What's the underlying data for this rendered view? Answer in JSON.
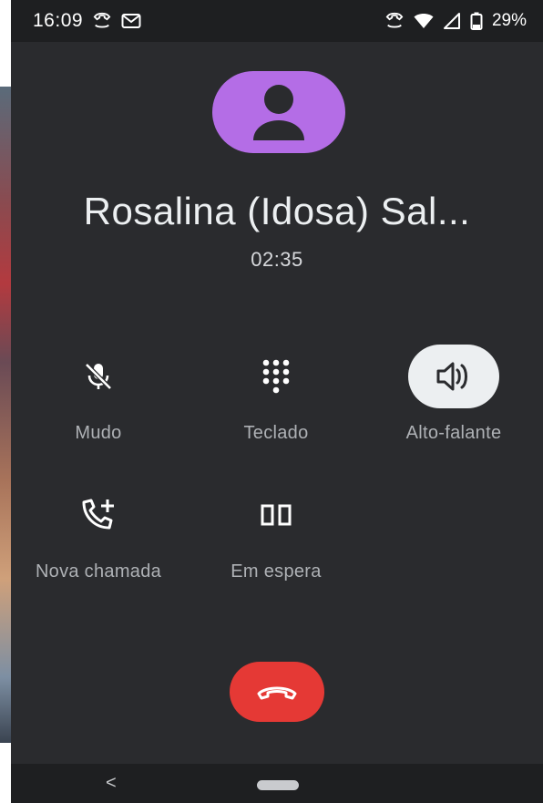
{
  "status_bar": {
    "time": "16:09",
    "battery": "29%"
  },
  "call": {
    "contact_name": "Rosalina (Idosa) Sal...",
    "timer": "02:35"
  },
  "controls": {
    "mute_label": "Mudo",
    "keypad_label": "Teclado",
    "speaker_label": "Alto-falante",
    "add_call_label": "Nova chamada",
    "hold_label": "Em espera"
  },
  "nav": {
    "back": "<"
  },
  "colors": {
    "background": "#2a2b2e",
    "avatar": "#b46de6",
    "end_call": "#e53935",
    "active_control": "#eceff1"
  }
}
